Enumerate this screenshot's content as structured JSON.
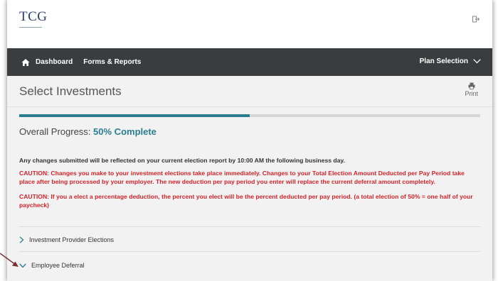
{
  "header": {
    "logo_text": "TCG",
    "logout_icon": "logout-icon"
  },
  "nav": {
    "home_icon": "home-icon",
    "dashboard": "Dashboard",
    "forms_reports": "Forms & Reports",
    "plan_selection": "Plan Selection"
  },
  "page": {
    "title": "Select Investments",
    "print_label": "Print"
  },
  "progress": {
    "label": "Overall Progress:",
    "value_text": "50% Complete",
    "fraction": 0.5
  },
  "messages": {
    "info": "Any changes submitted will be reflected on your current election report by 10:00 AM the following business day.",
    "caution1": "CAUTION: Changes you make to your investment elections take place immediately. Changes to your Total Election Amount Deducted per Pay Period take place after being processed by your employer. The new deduction per pay period you enter will replace the current deferral amount completely.",
    "caution2": "CAUTION: If you a elect a percentage deduction, the percent you elect will be the percent deducted per pay period. (a total election of 50% = one half of your paycheck)"
  },
  "accordion": {
    "items": [
      {
        "label": "Investment Provider Elections",
        "expanded": false
      },
      {
        "label": "Employee Deferral",
        "expanded": true
      }
    ]
  },
  "colors": {
    "accent": "#2a7d8e",
    "nav_bg": "#3a3d40",
    "caution": "#d4242a"
  }
}
